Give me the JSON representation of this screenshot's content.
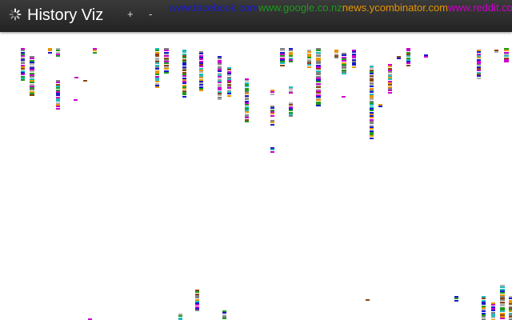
{
  "header": {
    "title": "History Viz",
    "zoom_in_label": "+",
    "zoom_out_label": "-",
    "loading_icon": "spinner-icon"
  },
  "legend": [
    {
      "label": "www.facebook.com",
      "color": "#1a1acc"
    },
    {
      "label": "www.google.co.nz",
      "color": "#1e9a1e"
    },
    {
      "label": "news.ycombinator.com",
      "color": "#e69500"
    },
    {
      "label": "www.reddit.com",
      "color": "#cc00cc"
    }
  ],
  "viz": {
    "palette": [
      "#1a1acc",
      "#1e9a1e",
      "#e69500",
      "#cc00cc",
      "#808080",
      "#22bbbb",
      "#8b4513",
      "#b0b0b0"
    ]
  }
}
